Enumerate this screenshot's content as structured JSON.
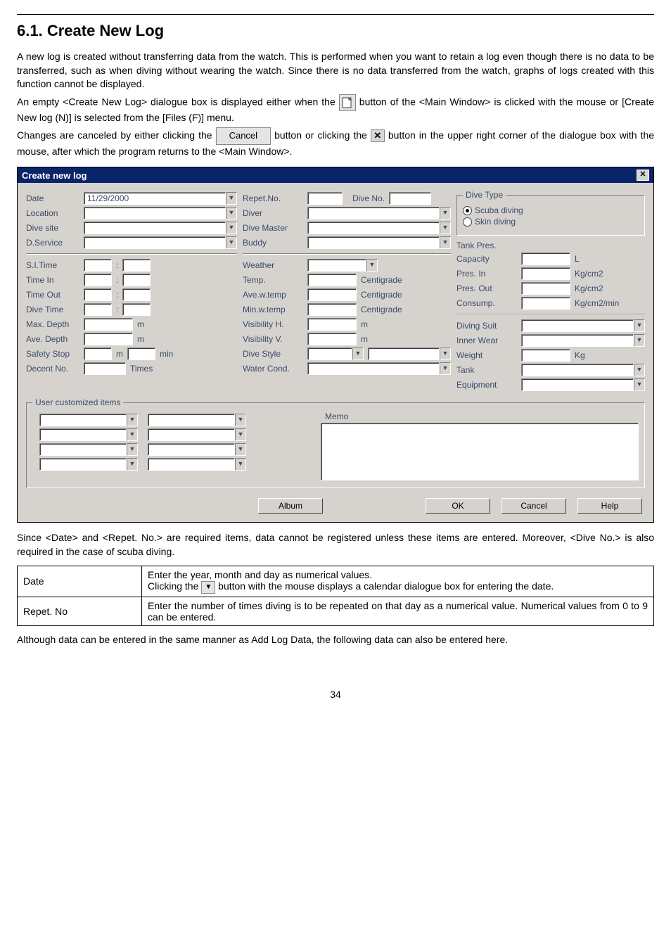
{
  "section": {
    "number": "6.1.",
    "title": "Create New Log"
  },
  "para1": "A new log is created without transferring data from the watch. This is performed when you want to retain a log even though there is no data to be transferred, such as when diving without wearing the watch. Since there is no data transferred from the watch, graphs of logs created with this function cannot be displayed.",
  "para2a": "An empty <Create New Log> dialogue box is displayed either when the ",
  "para2b": " button of the <Main Window> is clicked with the mouse or [Create New log (N)] is selected from the [Files (F)] menu.",
  "para3a": "Changes are canceled by either clicking the ",
  "para3_cancel": "Cancel",
  "para3b": " button or clicking the ",
  "para3c": " button in the upper right corner of the dialogue box with the mouse, after which the program returns to the <Main Window>.",
  "dialog": {
    "title": "Create new log",
    "left": {
      "date_lbl": "Date",
      "date_val": "11/29/2000",
      "loc_lbl": "Location",
      "site_lbl": "Dive site",
      "serv_lbl": "D.Service",
      "sitime_lbl": "S.I.Time",
      "timein_lbl": "Time In",
      "timeout_lbl": "Time Out",
      "divetime_lbl": "Dive Time",
      "maxd_lbl": "Max. Depth",
      "m1": "m",
      "aved_lbl": "Ave. Depth",
      "m2": "m",
      "safe_lbl": "Safety Stop",
      "m3": "m",
      "min": "min",
      "decent_lbl": "Decent No.",
      "times": "Times"
    },
    "mid": {
      "repet_lbl": "Repet.No.",
      "dive_no_lbl": "Dive No.",
      "diver_lbl": "Diver",
      "dmaster_lbl": "Dive Master",
      "buddy_lbl": "Buddy",
      "weather_lbl": "Weather",
      "temp_lbl": "Temp.",
      "temp_u": "Centigrade",
      "avew_lbl": "Ave.w.temp",
      "avew_u": "Centigrade",
      "minw_lbl": "Min.w.temp",
      "minw_u": "Centigrade",
      "vish_lbl": "Visibility H.",
      "vish_u": "m",
      "visv_lbl": "Visibility V.",
      "visv_u": "m",
      "dstyle_lbl": "Dive Style",
      "wcond_lbl": "Water Cond."
    },
    "right": {
      "dtype_legend": "Dive Type",
      "scuba": "Scuba diving",
      "skin": "Skin diving",
      "tank_lbl": "Tank Pres.",
      "cap_lbl": "Capacity",
      "cap_u": "L",
      "presin_lbl": "Pres. In",
      "presin_u": "Kg/cm2",
      "presout_lbl": "Pres. Out",
      "presout_u": "Kg/cm2",
      "consump_lbl": "Consump.",
      "consump_u": "Kg/cm2/min",
      "dsuit_lbl": "Diving Suit",
      "iwear_lbl": "Inner Wear",
      "weight_lbl": "Weight",
      "weight_u": "Kg",
      "tank2_lbl": "Tank",
      "equip_lbl": "Equipment"
    },
    "user_legend": "User customized items",
    "memo_lbl": "Memo",
    "buttons": {
      "album": "Album",
      "ok": "OK",
      "cancel": "Cancel",
      "help": "Help"
    }
  },
  "para4": "Since <Date> and <Repet. No.> are required items, data cannot be registered unless these items are entered. Moreover, <Dive No.> is also required in the case of scuba diving.",
  "table": {
    "date_key": "Date",
    "date_l1": "Enter the year, month and day as numerical values.",
    "date_l2a": "Clicking the ",
    "date_l2b": " button with the mouse displays a calendar dialogue box for entering the date.",
    "repet_key": "Repet. No",
    "repet_val": "Enter the number of times diving is to be repeated on that day as a numerical value. Numerical values from 0 to 9 can be entered."
  },
  "para5": "Although data can be entered in the same manner as Add Log Data, the following data can also be entered here.",
  "page_number": "34"
}
